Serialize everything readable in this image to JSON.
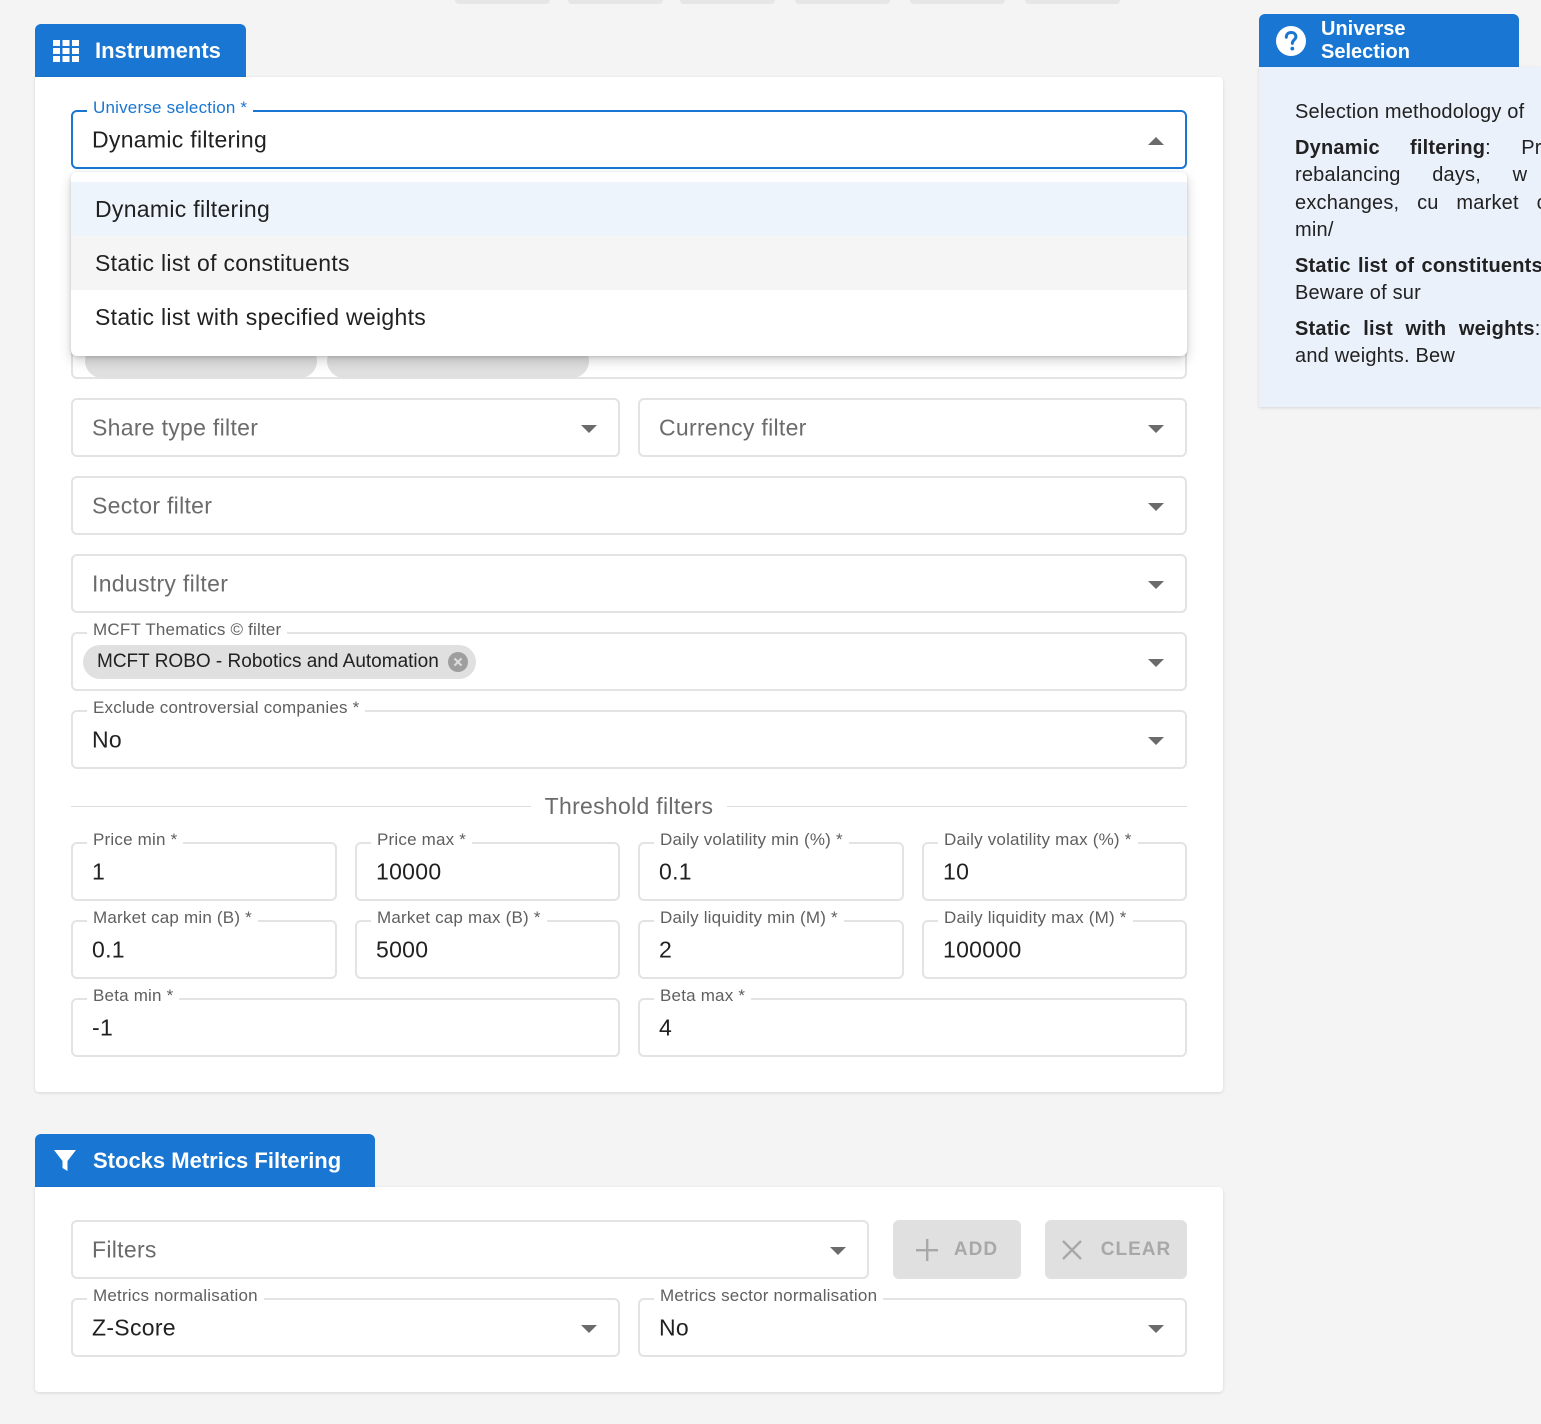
{
  "instruments": {
    "title": "Instruments",
    "icon": "grid-icon",
    "universe_selection": {
      "label": "Universe selection *",
      "value": "Dynamic filtering",
      "options": [
        "Dynamic filtering",
        "Static list of constituents",
        "Static list with specified weights"
      ]
    },
    "share_type_filter": {
      "placeholder": "Share type filter"
    },
    "currency_filter": {
      "placeholder": "Currency filter"
    },
    "sector_filter": {
      "placeholder": "Sector filter"
    },
    "industry_filter": {
      "placeholder": "Industry filter"
    },
    "thematics_filter": {
      "label": "MCFT Thematics © filter",
      "chips": [
        "MCFT ROBO - Robotics and Automation"
      ]
    },
    "exclude_controversial": {
      "label": "Exclude controversial companies *",
      "value": "No"
    },
    "threshold_title": "Threshold filters",
    "thresholds": {
      "price_min": {
        "label": "Price min *",
        "value": "1"
      },
      "price_max": {
        "label": "Price max *",
        "value": "10000"
      },
      "vol_min": {
        "label": "Daily volatility min (%) *",
        "value": "0.1"
      },
      "vol_max": {
        "label": "Daily volatility max (%) *",
        "value": "10"
      },
      "mcap_min": {
        "label": "Market cap min (B) *",
        "value": "0.1"
      },
      "mcap_max": {
        "label": "Market cap max (B) *",
        "value": "5000"
      },
      "liq_min": {
        "label": "Daily liquidity min (M) *",
        "value": "2"
      },
      "liq_max": {
        "label": "Daily liquidity max (M) *",
        "value": "100000"
      },
      "beta_min": {
        "label": "Beta min *",
        "value": "-1"
      },
      "beta_max": {
        "label": "Beta max *",
        "value": "4"
      }
    }
  },
  "metrics": {
    "title": "Stocks Metrics Filtering",
    "icon": "filter-icon",
    "filters": {
      "placeholder": "Filters"
    },
    "add_label": "ADD",
    "clear_label": "CLEAR",
    "normalisation": {
      "label": "Metrics normalisation",
      "value": "Z-Score"
    },
    "sector_normalisation": {
      "label": "Metrics sector normalisation",
      "value": "No"
    }
  },
  "help": {
    "title": "Universe Selection",
    "icon": "help-circle-icon",
    "intro": "Selection methodology of",
    "dynamic_term": "Dynamic filtering",
    "dynamic_text": ": Pre-filt each rebalancing days, w such as exchanges, cu market capitalization min/",
    "static_term": "Static list of constituents",
    "static_text": " of symbols. Beware of sur",
    "weights_term": "Static list with weights",
    "weights_text": ": U symbols and weights. Bew"
  },
  "colors": {
    "accent": "#1976d2",
    "selected_option": "#eef4fc",
    "help_bg": "#eaf1fb"
  }
}
